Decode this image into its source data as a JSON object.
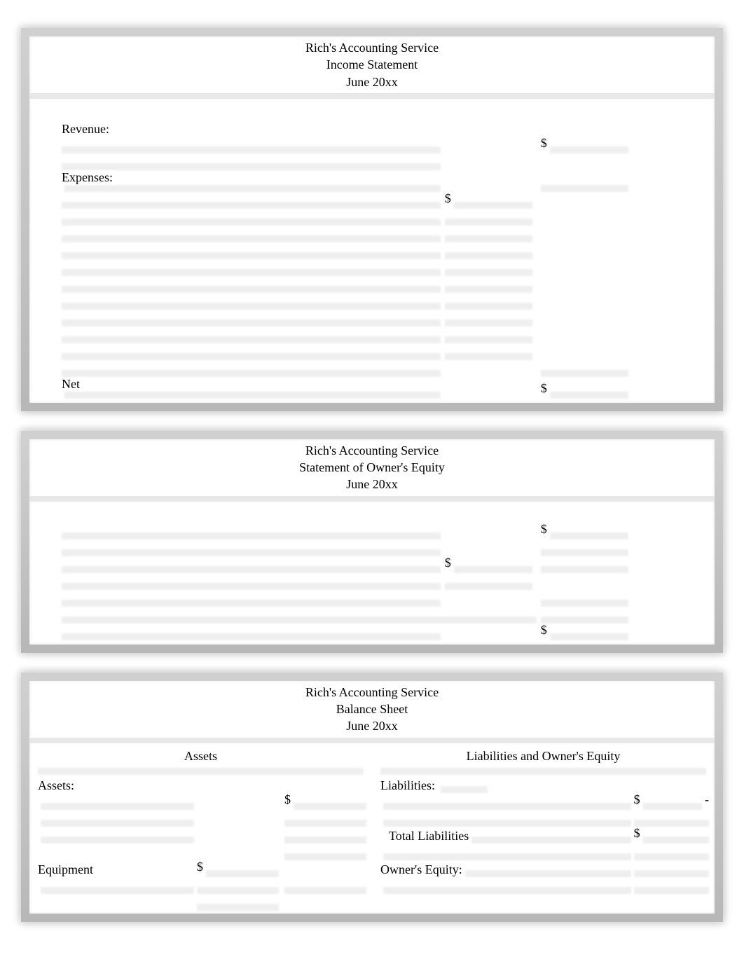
{
  "income_statement": {
    "company": "Rich's Accounting Service",
    "title": "Income Statement",
    "period": "June 20xx",
    "revenue_label": "Revenue:",
    "expenses_label": "Expenses:",
    "net_label": "Net",
    "currency": "$"
  },
  "owners_equity": {
    "company": "Rich's Accounting Service",
    "title": "Statement of Owner's Equity",
    "period": "June 20xx",
    "currency": "$"
  },
  "balance_sheet": {
    "company": "Rich's Accounting Service",
    "title": "Balance Sheet",
    "period": "June 20xx",
    "assets_heading": "Assets",
    "liabilities_equity_heading": "Liabilities and Owner's Equity",
    "assets_label": "Assets:",
    "equipment_label": "Equipment",
    "liabilities_label": "Liabilities:",
    "total_liabilities_label": "Total Liabilities",
    "owners_equity_label": "Owner's Equity:",
    "currency": "$",
    "dash": "-"
  }
}
